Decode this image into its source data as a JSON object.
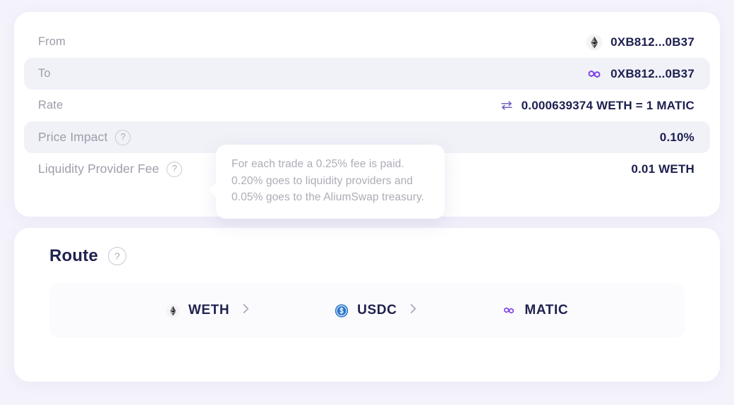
{
  "details": {
    "rows": [
      {
        "label": "From",
        "value": "0XB812...0B37",
        "icon": "ethereum-icon",
        "striped": false,
        "help": false
      },
      {
        "label": "To",
        "value": "0XB812...0B37",
        "icon": "polygon-icon",
        "striped": true,
        "help": false
      },
      {
        "label": "Rate",
        "value": "0.000639374 WETH = 1 MATIC",
        "icon": "swap-arrows-icon",
        "striped": false,
        "help": false
      },
      {
        "label": "Price Impact",
        "value": "0.10%",
        "icon": "",
        "striped": true,
        "help": true,
        "help_glyph": "?"
      },
      {
        "label": "Liquidity Provider Fee",
        "value": "0.01 WETH",
        "icon": "",
        "striped": false,
        "help": true,
        "help_glyph": "?"
      }
    ]
  },
  "tooltip": {
    "text": "For each trade a 0.25% fee is paid. 0.20% goes to liquidity providers and 0.05% goes to the AliumSwap treasury."
  },
  "route": {
    "title": "Route",
    "help_glyph": "?",
    "steps": [
      {
        "label": "WETH",
        "icon": "ethereum-icon",
        "chevron": true
      },
      {
        "label": "USDC",
        "icon": "usdc-icon",
        "chevron": true
      },
      {
        "label": "MATIC",
        "icon": "polygon-icon",
        "chevron": false
      }
    ]
  },
  "colors": {
    "page_background": "#f4f3fb",
    "card_background": "#ffffff",
    "row_stripe": "#f1f2f8",
    "label_text": "#9d9daa",
    "value_text": "#1d1f4f",
    "polygon_purple": "#8247e5",
    "usdc_blue": "#2775ca",
    "tooltip_text": "#acacb8"
  }
}
